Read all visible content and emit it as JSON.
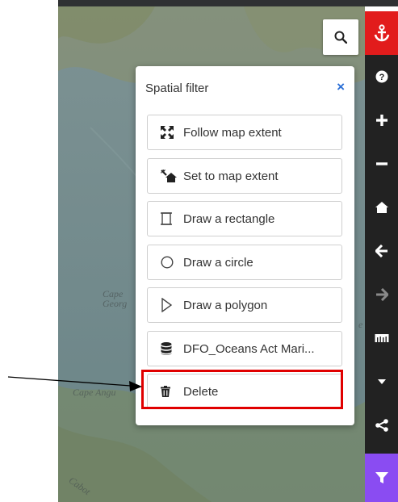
{
  "map": {
    "labels": [
      "Cape",
      "Georg",
      "Cape Angu",
      "Cabot",
      "e"
    ]
  },
  "search": {
    "icon": "search-icon"
  },
  "toolbar": {
    "buttons": [
      {
        "name": "anchor-icon",
        "color": "#e21c1c"
      },
      {
        "name": "help-icon"
      },
      {
        "name": "zoom-in-icon"
      },
      {
        "name": "zoom-out-icon"
      },
      {
        "name": "home-icon"
      },
      {
        "name": "back-arrow-icon"
      },
      {
        "name": "forward-arrow-icon",
        "state": "disabled"
      },
      {
        "name": "scale-bar-icon"
      },
      {
        "name": "caret-down-icon"
      },
      {
        "name": "share-icon"
      },
      {
        "name": "filter-icon",
        "color": "#8a4cf2"
      }
    ]
  },
  "panel": {
    "title": "Spatial filter",
    "close": "×",
    "options": [
      {
        "label": "Follow map extent",
        "icon": "expand-arrows-icon"
      },
      {
        "label": "Set to map extent",
        "icon": "magic-home-icon"
      },
      {
        "label": "Draw a rectangle",
        "icon": "rectangle-icon"
      },
      {
        "label": "Draw a circle",
        "icon": "circle-icon"
      },
      {
        "label": "Draw a polygon",
        "icon": "polygon-icon"
      },
      {
        "label": "DFO_Oceans Act Mari...",
        "icon": "database-icon"
      },
      {
        "label": "Delete",
        "icon": "trash-icon"
      }
    ]
  },
  "annotation": {
    "highlight_color": "#e00000",
    "arrow_color": "#000000"
  }
}
